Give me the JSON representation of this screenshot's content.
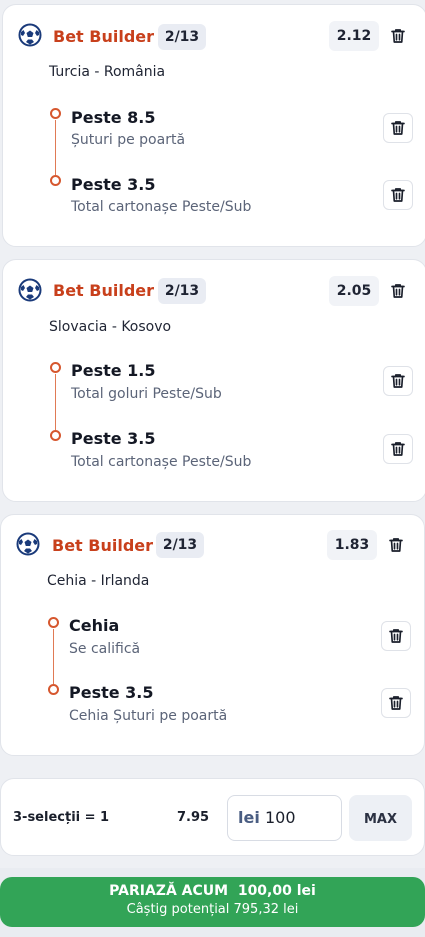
{
  "colors": {
    "accent": "#c8401c",
    "green": "#32a457",
    "ball": "#1a3a7a"
  },
  "bets": [
    {
      "title": "Bet Builder",
      "count": "2/13",
      "odds": "2.12",
      "match": "Turcia - România",
      "selections": [
        {
          "name": "Peste 8.5",
          "market": "Șuturi pe poartă"
        },
        {
          "name": "Peste 3.5",
          "market": "Total cartonașe Peste/Sub"
        }
      ]
    },
    {
      "title": "Bet Builder",
      "count": "2/13",
      "odds": "2.05",
      "match": "Slovacia - Kosovo",
      "selections": [
        {
          "name": "Peste 1.5",
          "market": "Total goluri Peste/Sub"
        },
        {
          "name": "Peste 3.5",
          "market": "Total cartonașe Peste/Sub"
        }
      ]
    },
    {
      "title": "Bet Builder",
      "count": "2/13",
      "odds": "1.83",
      "match": "Cehia - Irlanda",
      "selections": [
        {
          "name": "Cehia",
          "market": "Se califică"
        },
        {
          "name": "Peste 3.5",
          "market": "Cehia Șuturi pe poartă"
        }
      ]
    }
  ],
  "stake": {
    "label": "3-selecții = 1",
    "odds": "7.95",
    "currency": "lei",
    "amount": "100",
    "max_label": "MAX"
  },
  "place_bet": {
    "label": "PARIAZĂ ACUM",
    "amount": "100,00 lei",
    "potential": "Câștig potențial 795,32 lei"
  }
}
